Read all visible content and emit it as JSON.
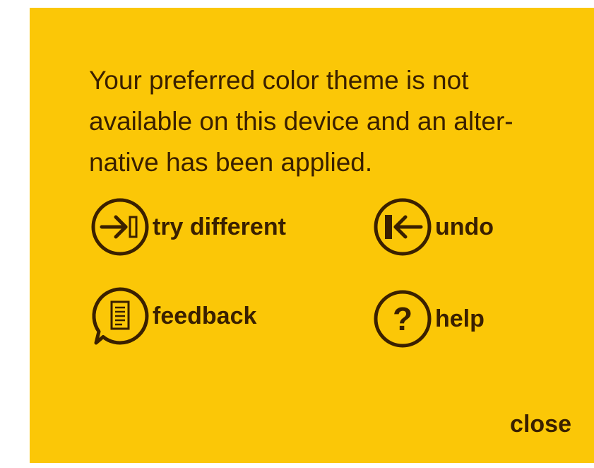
{
  "dialog": {
    "message": "Your preferred color theme is not available on this device and an alter-native has been applied.",
    "message_lines": [
      "Your preferred color theme is not",
      "available on this device and an alter-",
      "native has been applied."
    ],
    "actions": {
      "try_different": {
        "label": "try different",
        "icon": "arrow-to-bar-icon"
      },
      "undo": {
        "label": "undo",
        "icon": "arrow-back-to-bar-icon"
      },
      "feedback": {
        "label": "feedback",
        "icon": "feedback-document-icon"
      },
      "help": {
        "label": "help",
        "icon": "question-mark-icon"
      }
    },
    "close_label": "close"
  },
  "colors": {
    "background": "#fbc707",
    "foreground": "#3a2000",
    "page": "#ffffff"
  }
}
